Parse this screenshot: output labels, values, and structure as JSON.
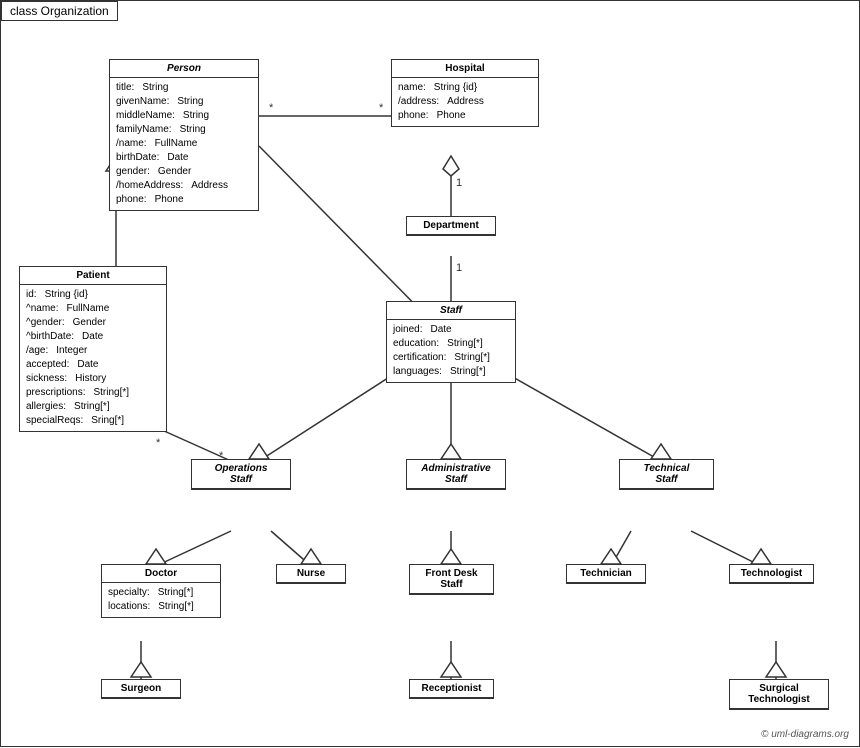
{
  "title": "class Organization",
  "copyright": "© uml-diagrams.org",
  "classes": {
    "person": {
      "name": "Person",
      "italic": true,
      "attrs": [
        [
          "title:",
          "String"
        ],
        [
          "givenName:",
          "String"
        ],
        [
          "middleName:",
          "String"
        ],
        [
          "familyName:",
          "String"
        ],
        [
          "/name:",
          "FullName"
        ],
        [
          "birthDate:",
          "Date"
        ],
        [
          "gender:",
          "Gender"
        ],
        [
          "/homeAddress:",
          "Address"
        ],
        [
          "phone:",
          "Phone"
        ]
      ]
    },
    "hospital": {
      "name": "Hospital",
      "italic": false,
      "attrs": [
        [
          "name:",
          "String {id}"
        ],
        [
          "/address:",
          "Address"
        ],
        [
          "phone:",
          "Phone"
        ]
      ]
    },
    "department": {
      "name": "Department",
      "italic": false,
      "attrs": []
    },
    "staff": {
      "name": "Staff",
      "italic": true,
      "attrs": [
        [
          "joined:",
          "Date"
        ],
        [
          "education:",
          "String[*]"
        ],
        [
          "certification:",
          "String[*]"
        ],
        [
          "languages:",
          "String[*]"
        ]
      ]
    },
    "patient": {
      "name": "Patient",
      "italic": false,
      "attrs": [
        [
          "id:",
          "String {id}"
        ],
        [
          "^name:",
          "FullName"
        ],
        [
          "^gender:",
          "Gender"
        ],
        [
          "^birthDate:",
          "Date"
        ],
        [
          "/age:",
          "Integer"
        ],
        [
          "accepted:",
          "Date"
        ],
        [
          "sickness:",
          "History"
        ],
        [
          "prescriptions:",
          "String[*]"
        ],
        [
          "allergies:",
          "String[*]"
        ],
        [
          "specialReqs:",
          "Sring[*]"
        ]
      ]
    },
    "operations_staff": {
      "name": "Operations Staff",
      "italic": true,
      "attrs": []
    },
    "administrative_staff": {
      "name": "Administrative Staff",
      "italic": true,
      "attrs": []
    },
    "technical_staff": {
      "name": "Technical Staff",
      "italic": true,
      "attrs": []
    },
    "doctor": {
      "name": "Doctor",
      "italic": false,
      "attrs": [
        [
          "specialty:",
          "String[*]"
        ],
        [
          "locations:",
          "String[*]"
        ]
      ]
    },
    "nurse": {
      "name": "Nurse",
      "italic": false,
      "attrs": []
    },
    "front_desk_staff": {
      "name": "Front Desk Staff",
      "italic": false,
      "attrs": []
    },
    "technician": {
      "name": "Technician",
      "italic": false,
      "attrs": []
    },
    "technologist": {
      "name": "Technologist",
      "italic": false,
      "attrs": []
    },
    "surgeon": {
      "name": "Surgeon",
      "italic": false,
      "attrs": []
    },
    "receptionist": {
      "name": "Receptionist",
      "italic": false,
      "attrs": []
    },
    "surgical_technologist": {
      "name": "Surgical Technologist",
      "italic": false,
      "attrs": []
    }
  }
}
